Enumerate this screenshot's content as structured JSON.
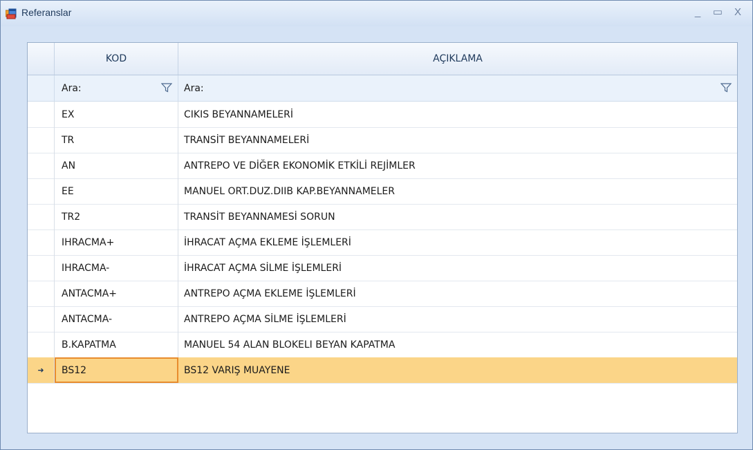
{
  "window": {
    "title": "Referanslar",
    "minimize_glyph": "_",
    "maximize_glyph": "▭",
    "close_glyph": "X"
  },
  "grid": {
    "columns": [
      "KOD",
      "AÇIKLAMA"
    ],
    "filter_placeholder": "Ara:",
    "rows": [
      {
        "kod": "EX",
        "aciklama": "CIKIS BEYANNAMELERİ"
      },
      {
        "kod": "TR",
        "aciklama": "TRANSİT BEYANNAMELERİ"
      },
      {
        "kod": "AN",
        "aciklama": "ANTREPO VE DİĞER EKONOMİK ETKİLİ REJİMLER"
      },
      {
        "kod": "EE",
        "aciklama": "MANUEL ORT.DUZ.DIIB KAP.BEYANNAMELER"
      },
      {
        "kod": "TR2",
        "aciklama": "TRANSİT BEYANNAMESİ SORUN"
      },
      {
        "kod": "IHRACMA+",
        "aciklama": "İHRACAT AÇMA EKLEME  İŞLEMLERİ"
      },
      {
        "kod": "IHRACMA-",
        "aciklama": "İHRACAT AÇMA SİLME İŞLEMLERİ"
      },
      {
        "kod": "ANTACMA+",
        "aciklama": "ANTREPO AÇMA EKLEME İŞLEMLERİ"
      },
      {
        "kod": "ANTACMA-",
        "aciklama": "ANTREPO AÇMA SİLME İŞLEMLERİ"
      },
      {
        "kod": "B.KAPATMA",
        "aciklama": "MANUEL 54 ALAN BLOKELI BEYAN KAPATMA"
      },
      {
        "kod": "BS12",
        "aciklama": "BS12 VARIŞ MUAYENE"
      }
    ],
    "selected_row_index": 10,
    "row_pointer_glyph": "➜"
  },
  "colors": {
    "selected_row": "#fbd588",
    "focused_cell_border": "#e88c2d",
    "title_text": "#1e395b"
  },
  "icons": {
    "app": "window-icon",
    "filter": "filter-funnel-icon"
  }
}
